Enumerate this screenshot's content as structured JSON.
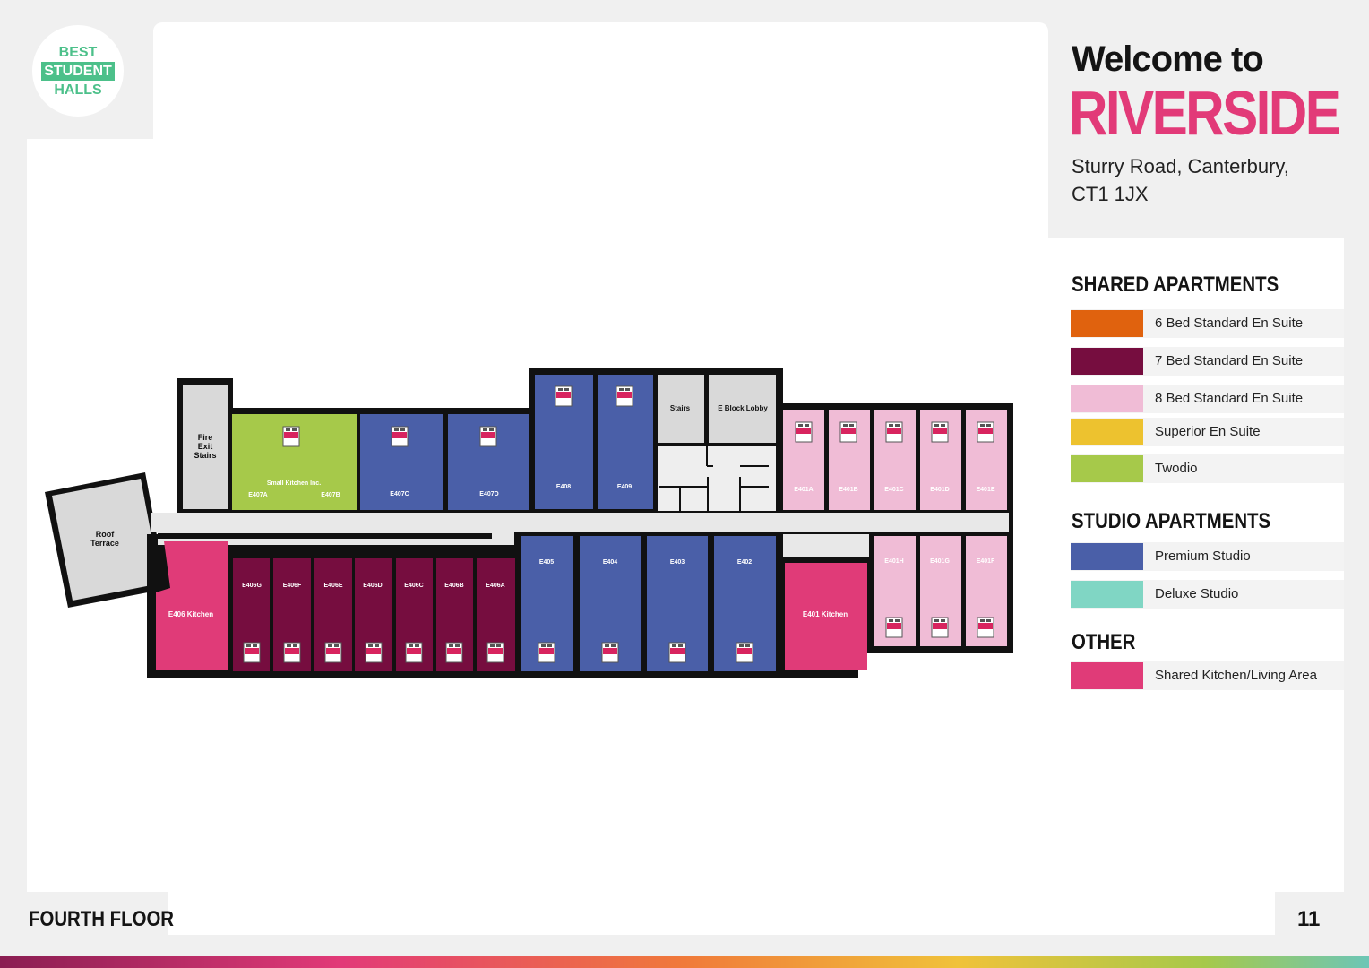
{
  "logo": {
    "line1": "BEST",
    "line2": "STUDENT",
    "line3": "HALLS"
  },
  "header": {
    "welcome": "Welcome to",
    "title": "RIVERSIDE",
    "address_line1": "Sturry Road, Canterbury,",
    "address_line2": "CT1 1JX"
  },
  "legend": {
    "shared_title": "SHARED APARTMENTS",
    "shared": [
      {
        "label": "6 Bed Standard En Suite",
        "color": "#e0620e"
      },
      {
        "label": "7 Bed Standard En Suite",
        "color": "#760d3f"
      },
      {
        "label": "8 Bed Standard En Suite",
        "color": "#f0bcd6"
      },
      {
        "label": "Superior En Suite",
        "color": "#edc22f"
      },
      {
        "label": "Twodio",
        "color": "#a6c94a"
      }
    ],
    "studio_title": "STUDIO APARTMENTS",
    "studio": [
      {
        "label": "Premium Studio",
        "color": "#4a5fa8"
      },
      {
        "label": "Deluxe Studio",
        "color": "#80d6c4"
      }
    ],
    "other_title": "OTHER",
    "other": [
      {
        "label": "Shared Kitchen/Living Area",
        "color": "#e03b78"
      }
    ]
  },
  "floorplan": {
    "roof_terrace": [
      "Roof",
      "Terrace"
    ],
    "fire_exit": [
      "Fire",
      "Exit",
      "Stairs"
    ],
    "twodio_label": "Small Kitchen Inc.",
    "e407a": "E407A",
    "e407b": "E407B",
    "e407c": "E407C",
    "e407d": "E407D",
    "e408": "E408",
    "e409": "E409",
    "stairs": "Stairs",
    "lobby": "E Block Lobby",
    "e401_top": [
      "E401A",
      "E401B",
      "E401C",
      "E401D",
      "E401E"
    ],
    "e401_bottom": [
      "E401H",
      "E401G",
      "E401F"
    ],
    "e406_kitchen": "E406 Kitchen",
    "e406_rooms": [
      "E406G",
      "E406F",
      "E406E",
      "E406D",
      "E406C",
      "E406B",
      "E406A"
    ],
    "premium_bottom": [
      "E405",
      "E404",
      "E403",
      "E402"
    ],
    "e401_kitchen": "E401 Kitchen"
  },
  "footer": {
    "floor": "FOURTH FLOOR",
    "page": "11"
  }
}
